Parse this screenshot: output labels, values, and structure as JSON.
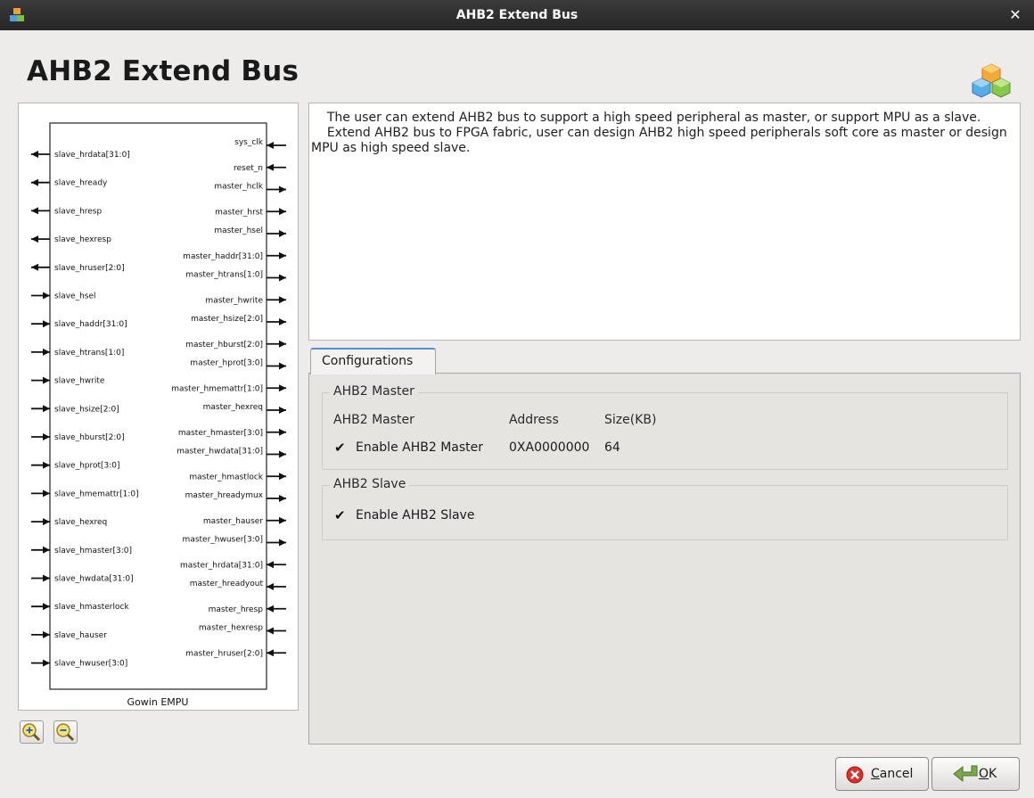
{
  "window": {
    "title": "AHB2 Extend Bus"
  },
  "heading": "AHB2 Extend Bus",
  "diagram": {
    "block_label": "Gowin EMPU",
    "left_ports": [
      {
        "name": "slave_hrdata[31:0]",
        "dir": "out"
      },
      {
        "name": "slave_hready",
        "dir": "out"
      },
      {
        "name": "slave_hresp",
        "dir": "out"
      },
      {
        "name": "slave_hexresp",
        "dir": "out"
      },
      {
        "name": "slave_hruser[2:0]",
        "dir": "out"
      },
      {
        "name": "slave_hsel",
        "dir": "in"
      },
      {
        "name": "slave_haddr[31:0]",
        "dir": "in"
      },
      {
        "name": "slave_htrans[1:0]",
        "dir": "in"
      },
      {
        "name": "slave_hwrite",
        "dir": "in"
      },
      {
        "name": "slave_hsize[2:0]",
        "dir": "in"
      },
      {
        "name": "slave_hburst[2:0]",
        "dir": "in"
      },
      {
        "name": "slave_hprot[3:0]",
        "dir": "in"
      },
      {
        "name": "slave_hmemattr[1:0]",
        "dir": "in"
      },
      {
        "name": "slave_hexreq",
        "dir": "in"
      },
      {
        "name": "slave_hmaster[3:0]",
        "dir": "in"
      },
      {
        "name": "slave_hwdata[31:0]",
        "dir": "in"
      },
      {
        "name": "slave_hmasterlock",
        "dir": "in"
      },
      {
        "name": "slave_hauser",
        "dir": "in"
      },
      {
        "name": "slave_hwuser[3:0]",
        "dir": "in"
      }
    ],
    "right_ports": [
      {
        "name": "sys_clk",
        "dir": "in"
      },
      {
        "name": "reset_n",
        "dir": "in"
      },
      {
        "name": "master_hclk",
        "dir": "out"
      },
      {
        "name": "master_hrst",
        "dir": "out"
      },
      {
        "name": "master_hsel",
        "dir": "out"
      },
      {
        "name": "master_haddr[31:0]",
        "dir": "out"
      },
      {
        "name": "master_htrans[1:0]",
        "dir": "out"
      },
      {
        "name": "master_hwrite",
        "dir": "out"
      },
      {
        "name": "master_hsize[2:0]",
        "dir": "out"
      },
      {
        "name": "master_hburst[2:0]",
        "dir": "out"
      },
      {
        "name": "master_hprot[3:0]",
        "dir": "out"
      },
      {
        "name": "master_hmemattr[1:0]",
        "dir": "out"
      },
      {
        "name": "master_hexreq",
        "dir": "out"
      },
      {
        "name": "master_hmaster[3:0]",
        "dir": "out"
      },
      {
        "name": "master_hwdata[31:0]",
        "dir": "out"
      },
      {
        "name": "master_hmastlock",
        "dir": "out"
      },
      {
        "name": "master_hreadymux",
        "dir": "out"
      },
      {
        "name": "master_hauser",
        "dir": "out"
      },
      {
        "name": "master_hwuser[3:0]",
        "dir": "out"
      },
      {
        "name": "master_hrdata[31:0]",
        "dir": "in"
      },
      {
        "name": "master_hreadyout",
        "dir": "in"
      },
      {
        "name": "master_hresp",
        "dir": "in"
      },
      {
        "name": "master_hexresp",
        "dir": "in"
      },
      {
        "name": "master_hruser[2:0]",
        "dir": "in"
      }
    ]
  },
  "description": "    The user can extend AHB2 bus to support a high speed peripheral as master, or support MPU as a slave.\n    Extend AHB2 bus to FPGA fabric, user can design AHB2 high speed peripherals soft core as master or design MPU as high speed slave.",
  "config": {
    "tab_label": "Configurations",
    "master_group": {
      "title": "AHB2 Master",
      "col_master": "AHB2 Master",
      "col_address": "Address",
      "col_size": "Size(KB)",
      "enable_label": "Enable AHB2 Master",
      "enable_checked": true,
      "address": "0XA0000000",
      "size": "64"
    },
    "slave_group": {
      "title": "AHB2 Slave",
      "enable_label": "Enable AHB2 Slave",
      "enable_checked": true
    }
  },
  "buttons": {
    "cancel_pre": "",
    "cancel_u": "C",
    "cancel_post": "ancel",
    "ok_u": "O",
    "ok_post": "K"
  },
  "icons": {
    "app": "app-cubes-icon",
    "close": "close-icon",
    "logo": "cubes-logo-icon",
    "zoom_in": "zoom-in-icon",
    "zoom_out": "zoom-out-icon",
    "cancel": "cancel-icon",
    "ok": "ok-arrow-icon"
  }
}
